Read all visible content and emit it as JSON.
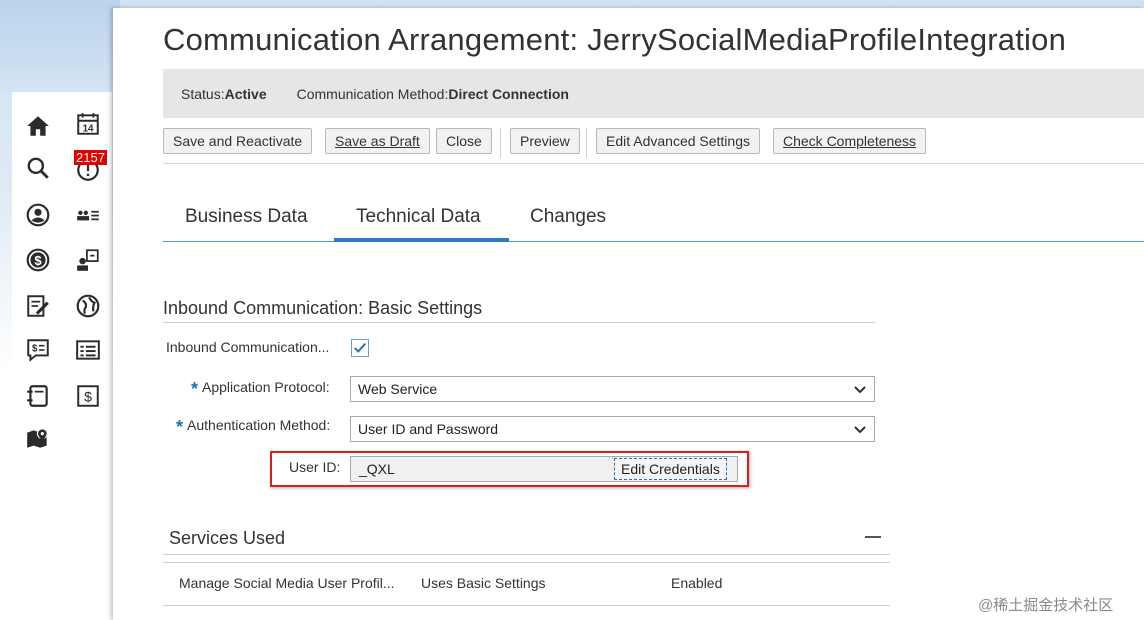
{
  "page": {
    "title": "Communication Arrangement: JerrySocialMediaProfileIntegration"
  },
  "header": {
    "status_label": "Status:",
    "status_value": "Active",
    "method_label": "Communication Method:",
    "method_value": "Direct Connection"
  },
  "toolbar": {
    "save_reactivate": "Save and Reactivate",
    "save_draft": "Save as Draft",
    "close": "Close",
    "preview": "Preview",
    "edit_advanced": "Edit Advanced Settings",
    "check_completeness": "Check Completeness"
  },
  "tabs": [
    {
      "label": "Business Data"
    },
    {
      "label": "Technical Data"
    },
    {
      "label": "Changes"
    }
  ],
  "inbound": {
    "section_title": "Inbound Communication: Basic Settings",
    "inbound_label": "Inbound Communication...",
    "inbound_checked": true,
    "protocol_label": "Application Protocol:",
    "protocol_value": "Web Service",
    "auth_label": "Authentication Method:",
    "auth_value": "User ID and Password",
    "userid_label": "User ID:",
    "userid_value": "_QXL",
    "edit_credentials": "Edit Credentials",
    "required_mark": "*"
  },
  "services": {
    "section_title": "Services Used",
    "rows": [
      {
        "service": "Manage Social Media User Profil...",
        "setting": "Uses Basic Settings",
        "status": "Enabled"
      }
    ]
  },
  "sidebar": {
    "badge_count": "2157",
    "calendar_day": "14",
    "icons": [
      "home-icon",
      "calendar-icon",
      "search-icon",
      "notification-icon",
      "user-circle-icon",
      "people-list-icon",
      "dollar-icon",
      "contact-card-icon",
      "edit-document-icon",
      "globe-icon",
      "chat-dollar-icon",
      "list-icon",
      "notebook-icon",
      "dollar-document-icon",
      "map-marker-icon"
    ]
  },
  "watermark": {
    "text": "@稀土掘金技术社区"
  },
  "colors": {
    "accent": "#2a7cc7",
    "required": "#1f6fb8",
    "highlight": "#d42020",
    "badge": "#e30000"
  }
}
